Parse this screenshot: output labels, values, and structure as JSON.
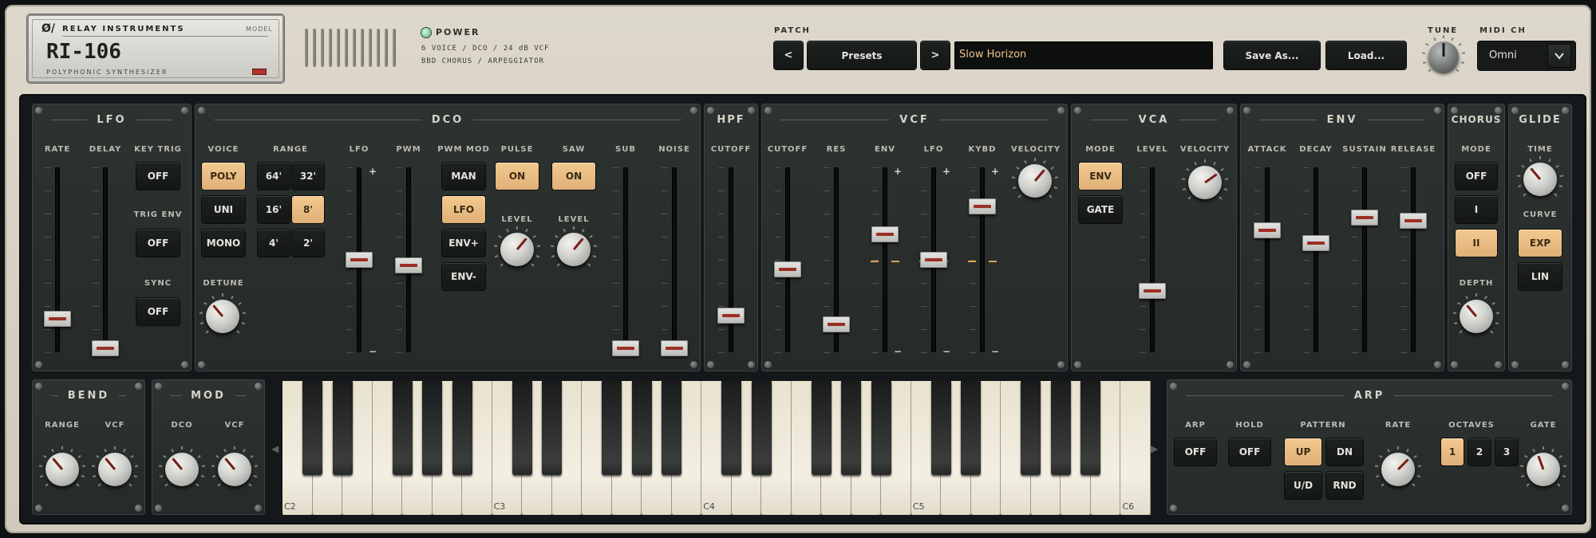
{
  "brand": {
    "logo": "Ø/",
    "maker": "RELAY INSTRUMENTS",
    "model_tag": "MODEL",
    "model": "RI-106",
    "subtitle": "POLYPHONIC SYNTHESIZER"
  },
  "power": {
    "label": "POWER",
    "line1": "6 VOICE / DCO / 24 dB VCF",
    "line2": "BBD CHORUS / ARPEGGIATOR",
    "led_color": "#7fd0a0"
  },
  "patch": {
    "label": "PATCH",
    "prev": "<",
    "presets": "Presets",
    "next": ">",
    "name": "Slow Horizon",
    "save": "Save As...",
    "load": "Load..."
  },
  "tune": {
    "label": "TUNE",
    "value": 0.5
  },
  "midi": {
    "label": "MIDI CH",
    "value": "Omni"
  },
  "lfo": {
    "title": "LFO",
    "rate": "RATE",
    "delay": "DELAY",
    "keytrig": "KEY TRIG",
    "keytrig_val": "OFF",
    "trigenv": "TRIG ENV",
    "trigenv_val": "OFF",
    "sync": "SYNC",
    "sync_val": "OFF",
    "rate_level": 0.18,
    "delay_level": 0.02
  },
  "dco": {
    "title": "DCO",
    "voice": "VOICE",
    "voice_opts": [
      "POLY",
      "UNI",
      "MONO"
    ],
    "range": "RANGE",
    "range_opts": [
      "64'",
      "32'",
      "16'",
      "8'",
      "4'",
      "2'"
    ],
    "detune": "DETUNE",
    "lfo": "LFO",
    "pwm": "PWM",
    "plus": "+",
    "minus": "−",
    "pwmmod": "PWM MOD",
    "pwmmod_opts": [
      "MAN",
      "LFO",
      "ENV+",
      "ENV-"
    ],
    "pulse": "PULSE",
    "pulse_val": "ON",
    "saw": "SAW",
    "saw_val": "ON",
    "level": "LEVEL",
    "sub": "SUB",
    "noise": "NOISE",
    "lfo_level": 0.5,
    "pwm_level": 0.47,
    "sub_level": 0.02,
    "noise_level": 0.02
  },
  "hpf": {
    "title": "HPF",
    "cutoff": "CUTOFF",
    "level": 0.2
  },
  "vcf": {
    "title": "VCF",
    "cutoff": "CUTOFF",
    "res": "RES",
    "env": "ENV",
    "lfo": "LFO",
    "kybd": "KYBD",
    "velocity": "VELOCITY",
    "cutoff_level": 0.45,
    "res_level": 0.15,
    "env_level": 0.64,
    "lfo_level": 0.5,
    "kybd_level": 0.79
  },
  "vca": {
    "title": "VCA",
    "mode": "MODE",
    "mode_opts": [
      "ENV",
      "GATE"
    ],
    "level": "LEVEL",
    "velocity": "VELOCITY",
    "level_level": 0.33
  },
  "env": {
    "title": "ENV",
    "attack": "ATTACK",
    "decay": "DECAY",
    "sustain": "SUSTAIN",
    "release": "RELEASE",
    "attack_level": 0.66,
    "decay_level": 0.59,
    "sustain_level": 0.73,
    "release_level": 0.71
  },
  "chorus": {
    "title": "CHORUS",
    "mode": "MODE",
    "opts": [
      "OFF",
      "I",
      "II"
    ],
    "depth": "DEPTH"
  },
  "glide": {
    "title": "GLIDE",
    "time": "TIME",
    "curve": "CURVE",
    "opts": [
      "EXP",
      "LIN"
    ]
  },
  "bend": {
    "title": "BEND",
    "range": "RANGE",
    "vcf": "VCF"
  },
  "mod": {
    "title": "MOD",
    "dco": "DCO",
    "vcf": "VCF"
  },
  "keyboard": {
    "octaves": [
      "C2",
      "C3",
      "C4",
      "C5",
      "C6"
    ],
    "left_arrow": "◀",
    "right_arrow": "▶"
  },
  "arp": {
    "title": "ARP",
    "arp": "ARP",
    "arp_val": "OFF",
    "hold": "HOLD",
    "hold_val": "OFF",
    "pattern": "PATTERN",
    "patterns": [
      "UP",
      "DN",
      "U/D",
      "RND"
    ],
    "rate": "RATE",
    "octaves": "OCTAVES",
    "octave_opts": [
      "1",
      "2",
      "3"
    ],
    "gate": "GATE"
  },
  "colors": {
    "accent": "#f0c48a",
    "panel": "#2b302f",
    "chassis": "#d6d1c3",
    "cap_stripe": "#9b2f25"
  }
}
